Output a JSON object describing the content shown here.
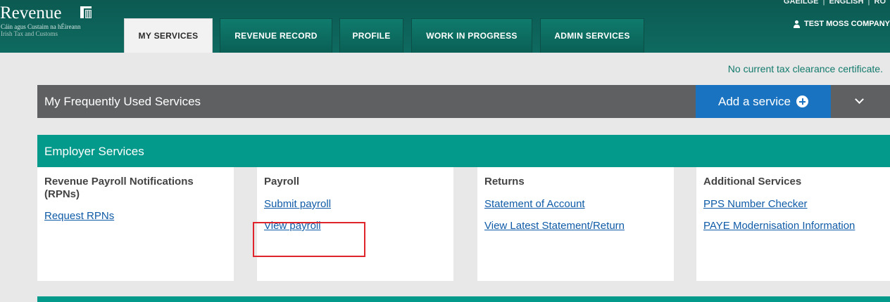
{
  "header": {
    "logo": {
      "wordmark": "Revenue",
      "subtitle_irish": "Cáin agus Custaim na hÉireann",
      "subtitle_english": "Irish Tax and Customs",
      "emblem": "harp-icon"
    },
    "tabs": [
      {
        "label": "MY SERVICES",
        "active": true
      },
      {
        "label": "REVENUE RECORD",
        "active": false
      },
      {
        "label": "PROFILE",
        "active": false
      },
      {
        "label": "WORK IN PROGRESS",
        "active": false
      },
      {
        "label": "ADMIN SERVICES",
        "active": false
      }
    ],
    "utility_links": [
      "GAEILGE",
      "ENGLISH",
      "RO"
    ],
    "user": {
      "icon": "user-icon",
      "name": "TEST MOSS COMPANY"
    }
  },
  "notice": "No current tax clearance certificate.",
  "frequent": {
    "title": "My Frequently Used Services",
    "add_label": "Add a service",
    "add_icon": "plus-circle-icon",
    "toggle_icon": "chevron-down-icon"
  },
  "employer": {
    "title": "Employer Services",
    "cards": [
      {
        "title": "Revenue Payroll Notifications (RPNs)",
        "links": [
          "Request RPNs"
        ]
      },
      {
        "title": "Payroll",
        "links": [
          "Submit payroll",
          "View payroll"
        ]
      },
      {
        "title": "Returns",
        "links": [
          "Statement of Account",
          "View Latest Statement/Return"
        ]
      },
      {
        "title": "Additional Services",
        "links": [
          "PPS Number Checker",
          "PAYE Modernisation Information"
        ]
      }
    ]
  },
  "colors": {
    "header_green": "#0c5a52",
    "teal": "#03998b",
    "bar_grey": "#5f6062",
    "add_blue": "#1a73c0",
    "link_blue": "#0f5ba7",
    "highlight_red": "#e0242b"
  }
}
